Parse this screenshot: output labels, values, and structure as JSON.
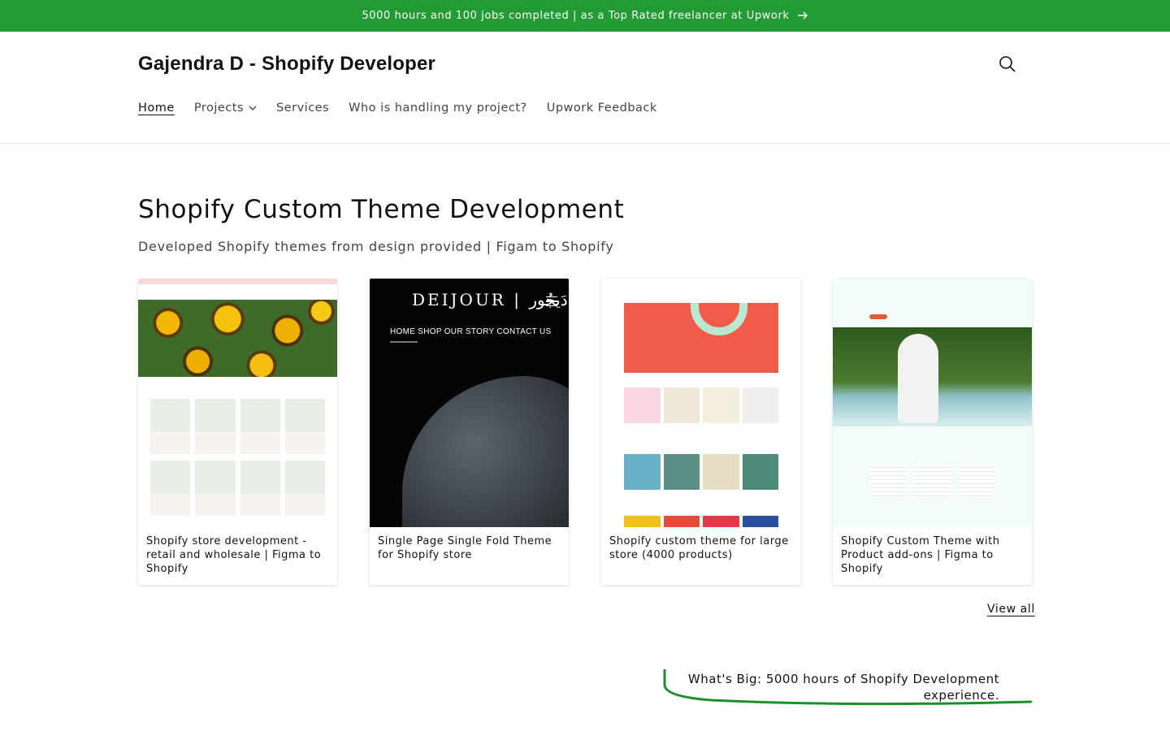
{
  "announcement": {
    "text": "5000 hours and 100 jobs completed | as a Top Rated freelancer at Upwork",
    "arrow_icon": "arrow-right-icon"
  },
  "header": {
    "brand": "Gajendra D - Shopify Developer",
    "search_icon": "search-icon",
    "nav": [
      {
        "label": "Home",
        "active": true
      },
      {
        "label": "Projects",
        "has_dropdown": true
      },
      {
        "label": "Services"
      },
      {
        "label": "Who is handling my project?"
      },
      {
        "label": "Upwork Feedback"
      }
    ]
  },
  "section": {
    "title": "Shopify Custom Theme Development",
    "subtitle": "Developed Shopify themes from design provided | Figam to Shopify",
    "cards": [
      {
        "title": "Shopify store development - retail and wholesale | Figma to Shopify"
      },
      {
        "title": "Single Page Single Fold Theme for Shopify store",
        "thumb_text": {
          "logo": "DEIJOUR | دَيجُور",
          "links": "HOME  SHOP  OUR STORY  CONTACT US"
        }
      },
      {
        "title": "Shopify custom theme for large store (4000 products)"
      },
      {
        "title": "Shopify Custom Theme with Product add-ons | Figma to Shopify"
      }
    ],
    "view_all": "View all"
  },
  "big": {
    "text": "What's Big: 5000 hours of Shopify Development experience."
  },
  "colors": {
    "announcement_bg": "#239b34",
    "accent_curve": "#1f8f2e"
  }
}
